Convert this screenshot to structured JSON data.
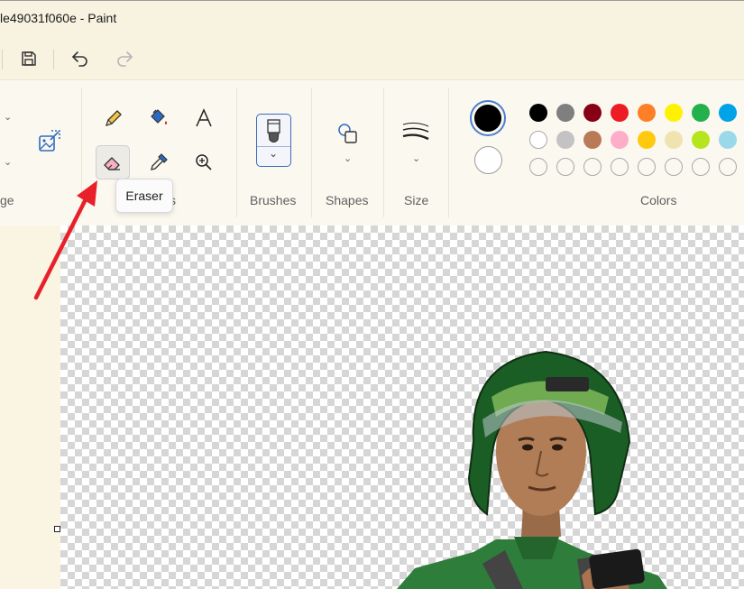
{
  "window": {
    "title": "le49031f060e - Paint"
  },
  "quick_access": {
    "save": "save-icon",
    "undo": "undo-icon",
    "redo": "redo-icon"
  },
  "ribbon": {
    "image_group_label": "ge",
    "tools_group_tail": "s",
    "brushes_label": "Brushes",
    "shapes_label": "Shapes",
    "size_label": "Size",
    "colors_label": "Colors",
    "tooltip": "Eraser"
  },
  "colors": {
    "primary": "#000000",
    "secondary": "#ffffff",
    "row1": [
      "#000000",
      "#7f7f7f",
      "#880015",
      "#ed1c24",
      "#ff7f27",
      "#fff200",
      "#22b14c",
      "#00a2e8"
    ],
    "row2": [
      "#ffffff",
      "#c3c3c3",
      "#b97a57",
      "#ffaec9",
      "#ffc90e",
      "#efe4b0",
      "#b5e61d",
      "#99d9ea"
    ],
    "accent": "#3a6bbf",
    "arrow": "#e8202a"
  }
}
